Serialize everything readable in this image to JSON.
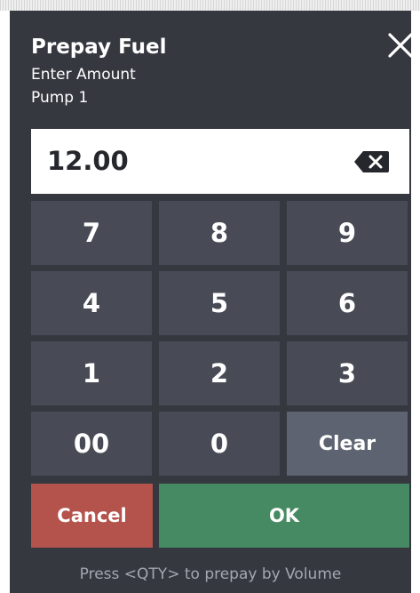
{
  "dialog": {
    "title": "Prepay Fuel",
    "subtitle": "Enter Amount",
    "pump_label": "Pump 1",
    "close_icon": "close-icon"
  },
  "amount": {
    "value": "12.00",
    "backspace_icon": "backspace-icon"
  },
  "keypad": {
    "keys": [
      "7",
      "8",
      "9",
      "4",
      "5",
      "6",
      "1",
      "2",
      "3",
      "00",
      "0",
      "Clear"
    ]
  },
  "actions": {
    "cancel_label": "Cancel",
    "ok_label": "OK"
  },
  "footer": {
    "hint": "Press <QTY> to prepay by Volume"
  },
  "colors": {
    "dialog_background": "#363840",
    "key_background": "#484b56",
    "clear_key_background": "#5d6371",
    "cancel_background": "#b4524c",
    "ok_background": "#468a63",
    "hint_text": "#a4a7b0"
  }
}
